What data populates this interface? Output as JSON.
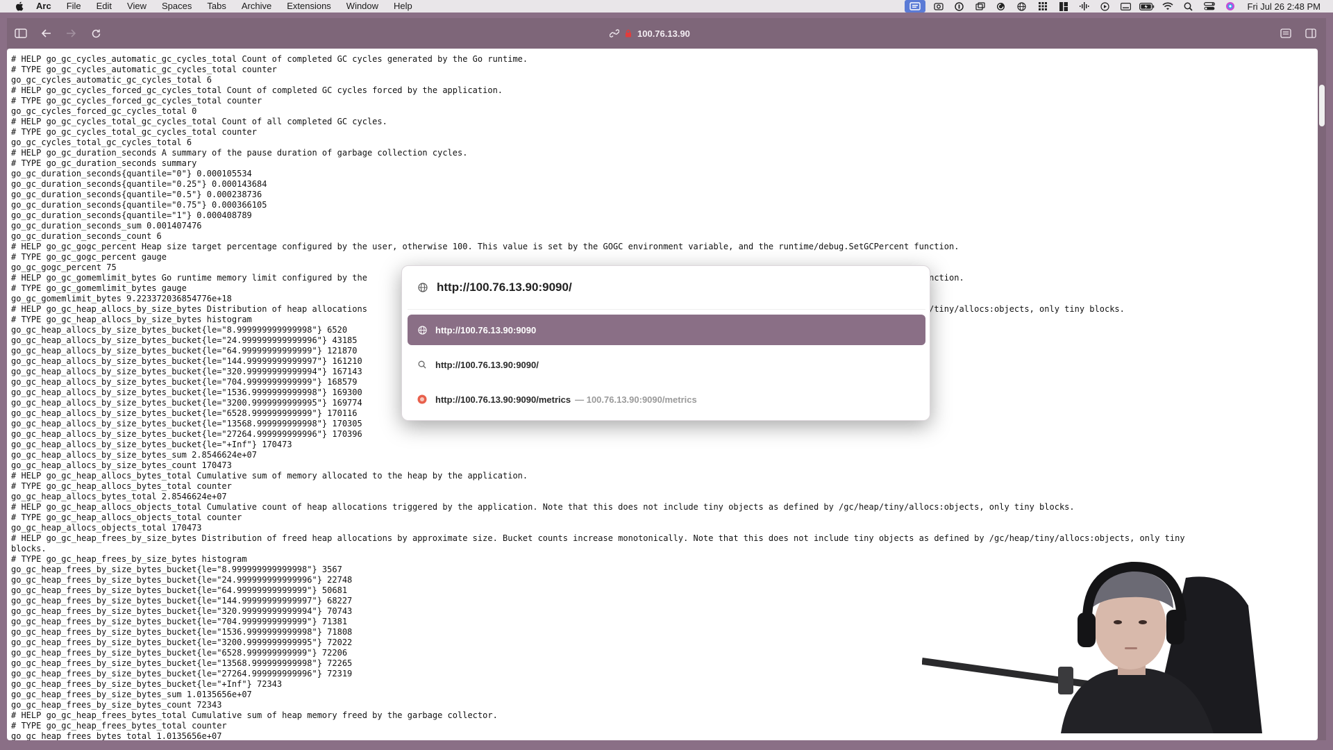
{
  "menubar": {
    "items": [
      "Arc",
      "File",
      "Edit",
      "View",
      "Spaces",
      "Tabs",
      "Archive",
      "Extensions",
      "Window",
      "Help"
    ],
    "clock": "Fri Jul 26  2:48 PM"
  },
  "toolbar": {
    "address": "100.76.13.90"
  },
  "command_bar": {
    "input_value": "http://100.76.13.90:9090/",
    "suggestions": [
      {
        "text": "http://100.76.13.90:9090",
        "sub": "",
        "icon": "globe-icon"
      },
      {
        "text": "http://100.76.13.90:9090/",
        "sub": "",
        "icon": "search-icon"
      },
      {
        "text": "http://100.76.13.90:9090/metrics",
        "sub": "— 100.76.13.90:9090/metrics",
        "icon": "favicon-icon"
      }
    ]
  },
  "metrics_lines": [
    "# HELP go_gc_cycles_automatic_gc_cycles_total Count of completed GC cycles generated by the Go runtime.",
    "# TYPE go_gc_cycles_automatic_gc_cycles_total counter",
    "go_gc_cycles_automatic_gc_cycles_total 6",
    "# HELP go_gc_cycles_forced_gc_cycles_total Count of completed GC cycles forced by the application.",
    "# TYPE go_gc_cycles_forced_gc_cycles_total counter",
    "go_gc_cycles_forced_gc_cycles_total 0",
    "# HELP go_gc_cycles_total_gc_cycles_total Count of all completed GC cycles.",
    "# TYPE go_gc_cycles_total_gc_cycles_total counter",
    "go_gc_cycles_total_gc_cycles_total 6",
    "# HELP go_gc_duration_seconds A summary of the pause duration of garbage collection cycles.",
    "# TYPE go_gc_duration_seconds summary",
    "go_gc_duration_seconds{quantile=\"0\"} 0.000105534",
    "go_gc_duration_seconds{quantile=\"0.25\"} 0.000143684",
    "go_gc_duration_seconds{quantile=\"0.5\"} 0.000238736",
    "go_gc_duration_seconds{quantile=\"0.75\"} 0.000366105",
    "go_gc_duration_seconds{quantile=\"1\"} 0.000408789",
    "go_gc_duration_seconds_sum 0.001407476",
    "go_gc_duration_seconds_count 6",
    "# HELP go_gc_gogc_percent Heap size target percentage configured by the user, otherwise 100. This value is set by the GOGC environment variable, and the runtime/debug.SetGCPercent function.",
    "# TYPE go_gc_gogc_percent gauge",
    "go_gc_gogc_percent 75",
    "# HELP go_gc_gomemlimit_bytes Go runtime memory limit configured by the                                                                                 runtime/debug.SetMemoryLimit function.",
    "# TYPE go_gc_gomemlimit_bytes gauge",
    "go_gc_gomemlimit_bytes 9.223372036854776e+18",
    "# HELP go_gc_heap_allocs_by_size_bytes Distribution of heap allocations                                                                                  objects as defined by /gc/heap/tiny/allocs:objects, only tiny blocks.",
    "# TYPE go_gc_heap_allocs_by_size_bytes histogram",
    "go_gc_heap_allocs_by_size_bytes_bucket{le=\"8.999999999999998\"} 6520",
    "go_gc_heap_allocs_by_size_bytes_bucket{le=\"24.999999999999996\"} 43185",
    "go_gc_heap_allocs_by_size_bytes_bucket{le=\"64.99999999999999\"} 121870",
    "go_gc_heap_allocs_by_size_bytes_bucket{le=\"144.99999999999997\"} 161210",
    "go_gc_heap_allocs_by_size_bytes_bucket{le=\"320.99999999999994\"} 167143",
    "go_gc_heap_allocs_by_size_bytes_bucket{le=\"704.9999999999999\"} 168579",
    "go_gc_heap_allocs_by_size_bytes_bucket{le=\"1536.9999999999998\"} 169300",
    "go_gc_heap_allocs_by_size_bytes_bucket{le=\"3200.9999999999995\"} 169774",
    "go_gc_heap_allocs_by_size_bytes_bucket{le=\"6528.999999999999\"} 170116",
    "go_gc_heap_allocs_by_size_bytes_bucket{le=\"13568.999999999998\"} 170305",
    "go_gc_heap_allocs_by_size_bytes_bucket{le=\"27264.999999999996\"} 170396",
    "go_gc_heap_allocs_by_size_bytes_bucket{le=\"+Inf\"} 170473",
    "go_gc_heap_allocs_by_size_bytes_sum 2.8546624e+07",
    "go_gc_heap_allocs_by_size_bytes_count 170473",
    "# HELP go_gc_heap_allocs_bytes_total Cumulative sum of memory allocated to the heap by the application.",
    "# TYPE go_gc_heap_allocs_bytes_total counter",
    "go_gc_heap_allocs_bytes_total 2.8546624e+07",
    "# HELP go_gc_heap_allocs_objects_total Cumulative count of heap allocations triggered by the application. Note that this does not include tiny objects as defined by /gc/heap/tiny/allocs:objects, only tiny blocks.",
    "# TYPE go_gc_heap_allocs_objects_total counter",
    "go_gc_heap_allocs_objects_total 170473",
    "# HELP go_gc_heap_frees_by_size_bytes Distribution of freed heap allocations by approximate size. Bucket counts increase monotonically. Note that this does not include tiny objects as defined by /gc/heap/tiny/allocs:objects, only tiny",
    "blocks.",
    "# TYPE go_gc_heap_frees_by_size_bytes histogram",
    "go_gc_heap_frees_by_size_bytes_bucket{le=\"8.999999999999998\"} 3567",
    "go_gc_heap_frees_by_size_bytes_bucket{le=\"24.999999999999996\"} 22748",
    "go_gc_heap_frees_by_size_bytes_bucket{le=\"64.99999999999999\"} 50681",
    "go_gc_heap_frees_by_size_bytes_bucket{le=\"144.99999999999997\"} 68227",
    "go_gc_heap_frees_by_size_bytes_bucket{le=\"320.99999999999994\"} 70743",
    "go_gc_heap_frees_by_size_bytes_bucket{le=\"704.9999999999999\"} 71381",
    "go_gc_heap_frees_by_size_bytes_bucket{le=\"1536.9999999999998\"} 71808",
    "go_gc_heap_frees_by_size_bytes_bucket{le=\"3200.9999999999995\"} 72022",
    "go_gc_heap_frees_by_size_bytes_bucket{le=\"6528.999999999999\"} 72206",
    "go_gc_heap_frees_by_size_bytes_bucket{le=\"13568.999999999998\"} 72265",
    "go_gc_heap_frees_by_size_bytes_bucket{le=\"27264.999999999996\"} 72319",
    "go_gc_heap_frees_by_size_bytes_bucket{le=\"+Inf\"} 72343",
    "go_gc_heap_frees_by_size_bytes_sum 1.0135656e+07",
    "go_gc_heap_frees_by_size_bytes_count 72343",
    "# HELP go_gc_heap_frees_bytes_total Cumulative sum of heap memory freed by the garbage collector.",
    "# TYPE go_gc_heap_frees_bytes_total counter",
    "go_gc_heap_frees_bytes_total 1.0135656e+07"
  ],
  "colors": {
    "accent": "#8a6f86",
    "toolbar": "#7e6679"
  }
}
